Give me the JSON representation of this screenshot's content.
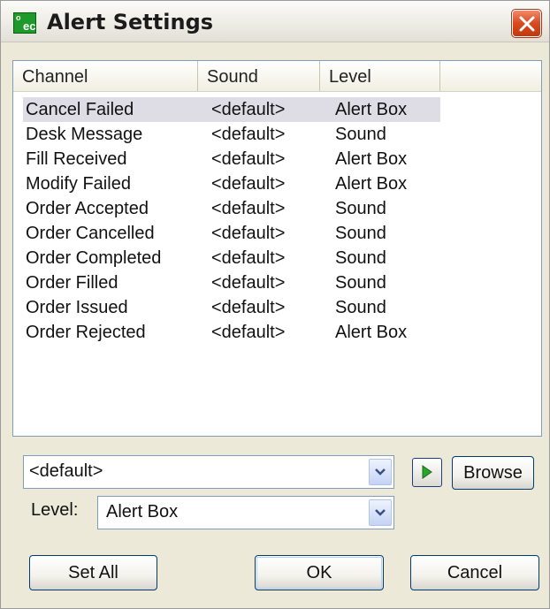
{
  "window": {
    "title": "Alert Settings",
    "icon": "oec-app-icon",
    "icon_text_top": "o",
    "icon_text_main": "ec"
  },
  "list": {
    "columns": [
      "Channel",
      "Sound",
      "Level"
    ],
    "selected_index": 0,
    "rows": [
      {
        "channel": "Cancel Failed",
        "sound": "<default>",
        "level": "Alert Box"
      },
      {
        "channel": "Desk Message",
        "sound": "<default>",
        "level": "Sound"
      },
      {
        "channel": "Fill Received",
        "sound": "<default>",
        "level": "Alert Box"
      },
      {
        "channel": "Modify Failed",
        "sound": "<default>",
        "level": "Alert Box"
      },
      {
        "channel": "Order Accepted",
        "sound": "<default>",
        "level": "Sound"
      },
      {
        "channel": "Order Cancelled",
        "sound": "<default>",
        "level": "Sound"
      },
      {
        "channel": "Order Completed",
        "sound": "<default>",
        "level": "Sound"
      },
      {
        "channel": "Order Filled",
        "sound": "<default>",
        "level": "Sound"
      },
      {
        "channel": "Order Issued",
        "sound": "<default>",
        "level": "Sound"
      },
      {
        "channel": "Order Rejected",
        "sound": "<default>",
        "level": "Alert Box"
      }
    ]
  },
  "controls": {
    "sound_value": "<default>",
    "browse_label": "Browse",
    "level_label": "Level:",
    "level_value": "Alert Box",
    "set_all_label": "Set All",
    "ok_label": "OK",
    "cancel_label": "Cancel"
  },
  "colors": {
    "window_bg": "#ece9d8",
    "selected_row": "#dedde6",
    "close_button": "#d8491f",
    "play_green": "#2aa52a"
  }
}
